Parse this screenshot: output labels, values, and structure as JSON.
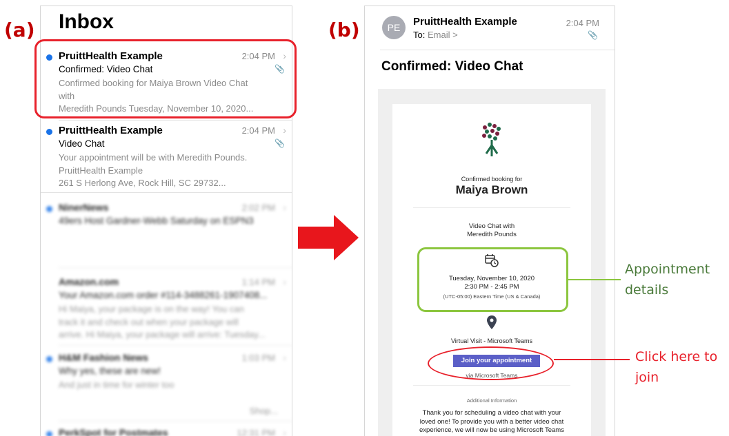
{
  "panel_labels": {
    "a": "(a)",
    "b": "(b)"
  },
  "inbox": {
    "title": "Inbox",
    "emails": [
      {
        "sender": "PruittHealth Example",
        "time": "2:04 PM",
        "subject": "Confirmed: Video Chat",
        "preview": "Confirmed booking for Maiya Brown Video Chat\nwith\nMeredith Pounds Tuesday, November 10, 2020...",
        "unread": true
      },
      {
        "sender": "PruittHealth Example",
        "time": "2:04 PM",
        "subject": "Video Chat",
        "preview": "Your appointment will be with Meredith Pounds.\nPruittHealth Example\n261 S Herlong Ave, Rock Hill, SC 29732...",
        "unread": true
      }
    ],
    "blurred_emails": [
      {
        "sender": "NinerNews",
        "time": "2:02 PM",
        "subject": "49ers Host Gardner-Webb Saturday on ESPN3",
        "preview": ""
      },
      {
        "sender": "Amazon.com",
        "time": "1:14 PM",
        "subject": "Your Amazon.com order #114-3488261-1907408...",
        "preview": "Hi Maiya, your package is on the way! You can\ntrack it and check out when your package will\narrive. Hi Maiya, your package will arrive: Tuesday..."
      },
      {
        "sender": "H&M Fashion News",
        "time": "1:03 PM",
        "subject": "Why yes, these are new!",
        "preview": "And just in time for winter too",
        "extra": "Shop..."
      },
      {
        "sender": "PerkSpot for Postmates",
        "time": "12:31 PM",
        "subject": "",
        "preview": ""
      }
    ]
  },
  "email": {
    "avatar_initials": "PE",
    "from": "PruittHealth Example",
    "to_label": "To:",
    "to_value": "Email >",
    "time": "2:04 PM",
    "subject": "Confirmed: Video Chat",
    "body": {
      "confirmed_label": "Confirmed booking for",
      "customer_name": "Maiya Brown",
      "service_line1": "Video Chat with",
      "service_line2": "Meredith Pounds",
      "date": "Tuesday, November 10, 2020",
      "time_range": "2:30 PM - 2:45 PM",
      "timezone": "(UTC-05:00) Eastern Time (US & Canada)",
      "location": "Virtual Visit - Microsoft Teams",
      "join_button": "Join your appointment",
      "via": "via Microsoft Teams",
      "additional_info": "Additional Information",
      "message": "Thank you for scheduling a video chat with your\nloved one! To provide you with a better video chat\nexperience, we will now be using Microsoft Teams\ninstead of Google Duo."
    }
  },
  "annotations": {
    "appointment_details": "Appointment\ndetails",
    "click_to_join": "Click here to\njoin"
  },
  "colors": {
    "highlight_red": "#e8212b",
    "highlight_green": "#8cc63f",
    "teams_purple": "#5b5fc7",
    "unread_blue": "#1a73e8",
    "label_red": "#c00000"
  }
}
